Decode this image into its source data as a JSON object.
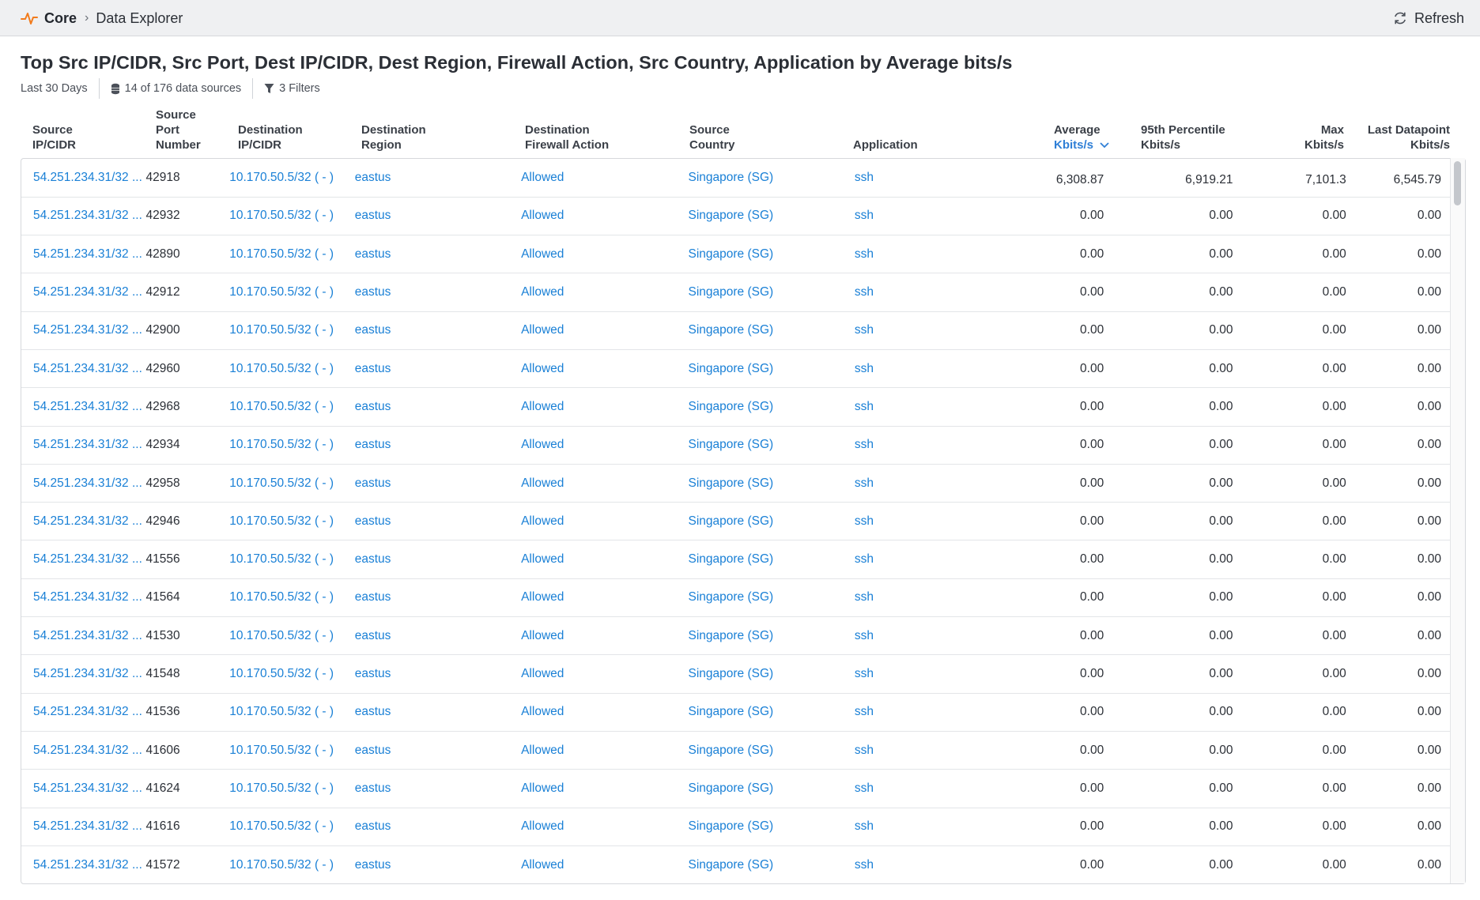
{
  "breadcrumb": {
    "root": "Core",
    "page": "Data Explorer"
  },
  "toolbar": {
    "refresh_label": "Refresh"
  },
  "report": {
    "title": "Top Src IP/CIDR, Src Port, Dest IP/CIDR, Dest Region, Firewall Action, Src Country, Application by Average bits/s",
    "time_range": "Last 30 Days",
    "data_sources": "14 of 176 data sources",
    "filters": "3 Filters"
  },
  "columns": [
    {
      "lines": [
        "Source",
        "IP/CIDR"
      ]
    },
    {
      "lines": [
        "Source",
        "Port",
        "Number"
      ]
    },
    {
      "lines": [
        "Destination",
        "IP/CIDR"
      ]
    },
    {
      "lines": [
        "Destination",
        "Region"
      ]
    },
    {
      "lines": [
        "Destination",
        "Firewall Action"
      ]
    },
    {
      "lines": [
        "Source",
        "Country"
      ]
    },
    {
      "lines": [
        "Application"
      ]
    },
    {
      "lines": [
        "Average",
        "Kbits/s"
      ],
      "sorted": true
    },
    {
      "lines": [
        "95th Percentile",
        "Kbits/s"
      ]
    },
    {
      "lines": [
        "Max",
        "Kbits/s"
      ]
    },
    {
      "lines": [
        "Last Datapoint",
        "Kbits/s"
      ]
    }
  ],
  "rows": [
    [
      "54.251.234.31/32 ...",
      "42918",
      "10.170.50.5/32 ( - )",
      "eastus",
      "Allowed",
      "Singapore (SG)",
      "ssh",
      "6,308.87",
      "6,919.21",
      "7,101.3",
      "6,545.79"
    ],
    [
      "54.251.234.31/32 ...",
      "42932",
      "10.170.50.5/32 ( - )",
      "eastus",
      "Allowed",
      "Singapore (SG)",
      "ssh",
      "0.00",
      "0.00",
      "0.00",
      "0.00"
    ],
    [
      "54.251.234.31/32 ...",
      "42890",
      "10.170.50.5/32 ( - )",
      "eastus",
      "Allowed",
      "Singapore (SG)",
      "ssh",
      "0.00",
      "0.00",
      "0.00",
      "0.00"
    ],
    [
      "54.251.234.31/32 ...",
      "42912",
      "10.170.50.5/32 ( - )",
      "eastus",
      "Allowed",
      "Singapore (SG)",
      "ssh",
      "0.00",
      "0.00",
      "0.00",
      "0.00"
    ],
    [
      "54.251.234.31/32 ...",
      "42900",
      "10.170.50.5/32 ( - )",
      "eastus",
      "Allowed",
      "Singapore (SG)",
      "ssh",
      "0.00",
      "0.00",
      "0.00",
      "0.00"
    ],
    [
      "54.251.234.31/32 ...",
      "42960",
      "10.170.50.5/32 ( - )",
      "eastus",
      "Allowed",
      "Singapore (SG)",
      "ssh",
      "0.00",
      "0.00",
      "0.00",
      "0.00"
    ],
    [
      "54.251.234.31/32 ...",
      "42968",
      "10.170.50.5/32 ( - )",
      "eastus",
      "Allowed",
      "Singapore (SG)",
      "ssh",
      "0.00",
      "0.00",
      "0.00",
      "0.00"
    ],
    [
      "54.251.234.31/32 ...",
      "42934",
      "10.170.50.5/32 ( - )",
      "eastus",
      "Allowed",
      "Singapore (SG)",
      "ssh",
      "0.00",
      "0.00",
      "0.00",
      "0.00"
    ],
    [
      "54.251.234.31/32 ...",
      "42958",
      "10.170.50.5/32 ( - )",
      "eastus",
      "Allowed",
      "Singapore (SG)",
      "ssh",
      "0.00",
      "0.00",
      "0.00",
      "0.00"
    ],
    [
      "54.251.234.31/32 ...",
      "42946",
      "10.170.50.5/32 ( - )",
      "eastus",
      "Allowed",
      "Singapore (SG)",
      "ssh",
      "0.00",
      "0.00",
      "0.00",
      "0.00"
    ],
    [
      "54.251.234.31/32 ...",
      "41556",
      "10.170.50.5/32 ( - )",
      "eastus",
      "Allowed",
      "Singapore (SG)",
      "ssh",
      "0.00",
      "0.00",
      "0.00",
      "0.00"
    ],
    [
      "54.251.234.31/32 ...",
      "41564",
      "10.170.50.5/32 ( - )",
      "eastus",
      "Allowed",
      "Singapore (SG)",
      "ssh",
      "0.00",
      "0.00",
      "0.00",
      "0.00"
    ],
    [
      "54.251.234.31/32 ...",
      "41530",
      "10.170.50.5/32 ( - )",
      "eastus",
      "Allowed",
      "Singapore (SG)",
      "ssh",
      "0.00",
      "0.00",
      "0.00",
      "0.00"
    ],
    [
      "54.251.234.31/32 ...",
      "41548",
      "10.170.50.5/32 ( - )",
      "eastus",
      "Allowed",
      "Singapore (SG)",
      "ssh",
      "0.00",
      "0.00",
      "0.00",
      "0.00"
    ],
    [
      "54.251.234.31/32 ...",
      "41536",
      "10.170.50.5/32 ( - )",
      "eastus",
      "Allowed",
      "Singapore (SG)",
      "ssh",
      "0.00",
      "0.00",
      "0.00",
      "0.00"
    ],
    [
      "54.251.234.31/32 ...",
      "41606",
      "10.170.50.5/32 ( - )",
      "eastus",
      "Allowed",
      "Singapore (SG)",
      "ssh",
      "0.00",
      "0.00",
      "0.00",
      "0.00"
    ],
    [
      "54.251.234.31/32 ...",
      "41624",
      "10.170.50.5/32 ( - )",
      "eastus",
      "Allowed",
      "Singapore (SG)",
      "ssh",
      "0.00",
      "0.00",
      "0.00",
      "0.00"
    ],
    [
      "54.251.234.31/32 ...",
      "41616",
      "10.170.50.5/32 ( - )",
      "eastus",
      "Allowed",
      "Singapore (SG)",
      "ssh",
      "0.00",
      "0.00",
      "0.00",
      "0.00"
    ],
    [
      "54.251.234.31/32 ...",
      "41572",
      "10.170.50.5/32 ( - )",
      "eastus",
      "Allowed",
      "Singapore (SG)",
      "ssh",
      "0.00",
      "0.00",
      "0.00",
      "0.00"
    ]
  ],
  "colors": {
    "link": "#1a80d6",
    "sorted_header": "#2f7fd6",
    "logo": "#f27b1c"
  },
  "icons": [
    "pulse-logo-icon",
    "chevron-right-icon",
    "refresh-icon",
    "database-icon",
    "filter-icon",
    "chevron-down-icon"
  ]
}
